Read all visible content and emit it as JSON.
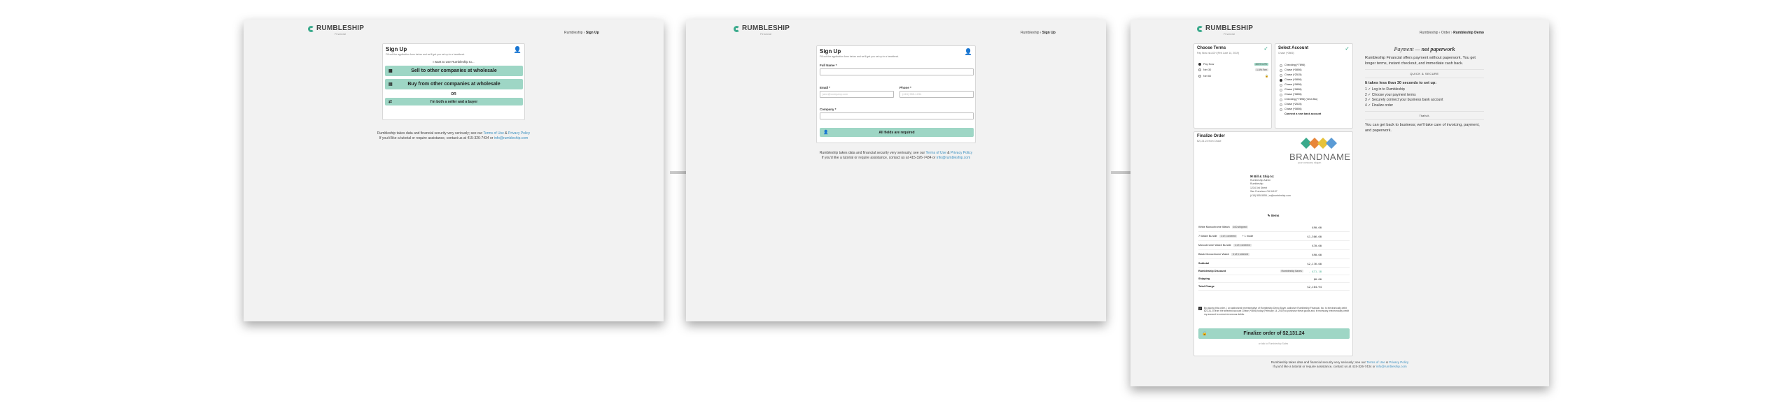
{
  "brand": {
    "name": "RUMBLESHIP",
    "sub": "Financial"
  },
  "s1": {
    "crumb_a": "Rumbleship",
    "crumb_b": "Sign Up",
    "title": "Sign Up",
    "subtitle": "Fill out the application form below and we'll get you set up in a heartbeat.",
    "prompt": "I want to use Rumbleship to...",
    "btn_sell": "Sell to other companies at wholesale",
    "btn_buy": "Buy from other companies at wholesale",
    "or": "OR",
    "btn_both": "I'm both a seller and a buyer",
    "foot1_a": "Rumbleship takes data and financial security very seriously; see our ",
    "foot1_terms": "Terms of Use",
    "foot1_and": " & ",
    "foot1_privacy": "Privacy Policy",
    "foot2_a": "If you'd like a tutorial or require assistance, contact us at 415-326-7434 or ",
    "foot2_email": "info@rumbleship.com"
  },
  "s2": {
    "crumb_a": "Rumbleship",
    "crumb_b": "Sign Up",
    "title": "Sign Up",
    "subtitle": "Fill out the application form below and we'll get you set up in a heartbeat.",
    "full_name": "Full Name *",
    "email": "Email *",
    "email_ph": "jane@company.com",
    "phone": "Phone *",
    "phone_ph": "(415) 555-1234",
    "company": "Company *",
    "submit": "All fields are required",
    "foot1_a": "Rumbleship takes data and financial security very seriously; see our ",
    "foot1_terms": "Terms of Use",
    "foot1_and": " & ",
    "foot1_privacy": "Privacy Policy",
    "foot2_a": "If you'd like a tutorial or require assistance, contact us at 415-326-7434 or ",
    "foot2_email": "info@rumbleship.com"
  },
  "s3": {
    "crumb_a": "Rumbleship",
    "crumb_sep": " › Order › ",
    "crumb_b": "Rumbleship Demo",
    "terms_title": "Choose Terms",
    "terms_sub": "Pay Now via ACH (Feb June 14, 2019)",
    "terms": [
      {
        "label": "Pay Now",
        "tag": "ACH 1.2%"
      },
      {
        "label": "Net 30",
        "tag": "1.5% Fee"
      },
      {
        "label": "Net 60",
        "tag": ""
      }
    ],
    "acct_title": "Select Account",
    "acct_sub": "Chase (*0806)",
    "accounts": [
      "Checking (*7896)",
      "Chase (*0806)",
      "Chase (*2515)",
      "Chase (*0806)",
      "Chase (*0806)",
      "Chase (*0806)",
      "Chase (*0806)",
      "Checking (*7896) (Vera Bio)",
      "Chase (*2515)",
      "Chase (*0806)",
      "Connect a new bank account"
    ],
    "fin_title": "Finalize Order",
    "fin_sub": "$2,131.24 from Chase",
    "brandname": "BRANDNAME",
    "brandtag": "your company slogan",
    "bill_title": "Bill & Ship to:",
    "bill_lines": [
      "Rumbleship Admin",
      "Rumbleship",
      "1234 3rd Street",
      "San Francisco CA 94107",
      "(415) 555-5555 | rs@rumbleship.com"
    ],
    "items_head": "Items",
    "items": [
      {
        "name": "White Monochrome Watch",
        "tag": "100 shipped",
        "extra": "",
        "price": "$90.00"
      },
      {
        "name": "7 Watch Bundle",
        "tag": "1 of 1 ordered",
        "extra": "+ 1 mode",
        "price": "$1,306.00"
      },
      {
        "name": "Monochrome Watch Bundle",
        "tag": "1 of 1 ordered",
        "extra": "",
        "price": "$70.00"
      },
      {
        "name": "Black Monochrome Watch",
        "tag": "1 of 1 ordered",
        "extra": "",
        "price": "$90.00"
      }
    ],
    "subtotal_l": "Subtotal",
    "subtotal": "$2,176.00",
    "discount_l": "Rumbleship Discount",
    "discount_tag": "Rumbleship Saves",
    "discount": "- $71.18",
    "shipping_l": "Shipping",
    "shipping": "$0.00",
    "total_l": "Total Charge",
    "total": "$2,104.94",
    "consent": "By placing this order, I, an authorized representative of Rumbleship Demo Buyer, authorize Rumbleship Financial, Inc. to electronically debit $2,131.24 from the selected account Chase (*0806) today (February 14, 2019) to purchase these goods and, if necessary, electronically credit my account to correct erroneous debits.",
    "cta": "Finalize order of $2,131.24",
    "cta_sub": "or talk to Rumbleship Sales",
    "pitch_title_a": "Payment — ",
    "pitch_title_b": "not paperwork",
    "pitch_body": "Rumbleship Financial offers payment without paperwork. You get longer terms, instant checkout, and immediate cash back.",
    "quick": "QUICK & SECURE",
    "setup": "It takes less than 30 seconds to set up:",
    "steps": [
      "Log in to Rumbleship",
      "Choose your payment terms",
      "Securely connect your business bank account",
      "Finalize order"
    ],
    "thats": "That's it.",
    "end": "You can get back to business; we'll take care of invoicing, payment, and paperwork.",
    "foot1_a": "Rumbleship takes data and financial security very seriously; see our ",
    "foot1_terms": "Terms of Use",
    "foot1_and": " & ",
    "foot1_privacy": "Privacy Policy",
    "foot2_a": "If you'd like a tutorial or require assistance, contact us at 415-326-7434 or ",
    "foot2_email": "info@rumbleship.com"
  }
}
